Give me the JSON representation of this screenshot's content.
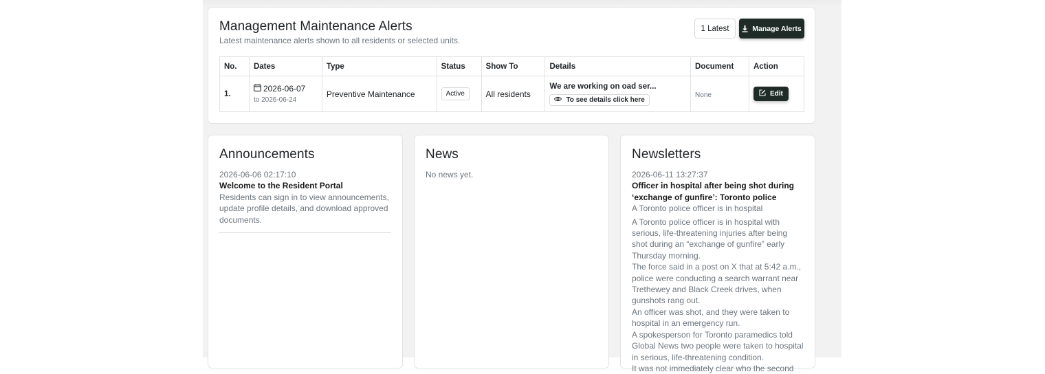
{
  "alerts": {
    "title": "Management Maintenance Alerts",
    "subtitle": "Latest maintenance alerts shown to all residents or selected units.",
    "latest_label": "1 Latest",
    "manage_label": "Manage Alerts",
    "columns": [
      "No.",
      "Dates",
      "Type",
      "Status",
      "Show To",
      "Details",
      "Document",
      "Action"
    ],
    "rows": [
      {
        "no": "1.",
        "date_start": "2026-06-07",
        "date_end": "to 2026-06-24",
        "type": "Preventive Maintenance",
        "status": "Active",
        "show_to": "All residents",
        "details_title": "We are working on oad ser...",
        "details_link": "To see details click here",
        "document": "None",
        "action": "Edit"
      }
    ]
  },
  "announcements": {
    "title": "Announcements",
    "items": [
      {
        "timestamp": "2026-06-06 02:17:10",
        "headline": "Welcome to the Resident Portal",
        "body": "Residents can sign in to view announcements, update profile details, and download approved documents."
      }
    ]
  },
  "news": {
    "title": "News",
    "empty_text": "No news yet."
  },
  "newsletters": {
    "title": "Newsletters",
    "timestamp": "2026-06-11 13:27:37",
    "headline": "Officer in hospital after being shot during ‘exchange of gunfire’: Toronto police",
    "summary": "A Toronto police officer is in hospital",
    "paragraphs": [
      "A Toronto police officer is in hospital with serious, life-threatening injuries after being shot during an “exchange of gunfire” early Thursday morning.",
      "The force said in a post on X that at 5:42 a.m., police were conducting a search warrant near Trethewey and Black Creek drives, when gunshots rang out.",
      "An officer was shot, and they were taken to hospital in an emergency run.",
      "A spokesperson for Toronto paramedics told Global News two people were taken to hospital in serious, life-threatening condition.",
      "It was not immediately clear who the second"
    ]
  },
  "colors": {
    "page_background": "#f2f2f2",
    "card_background": "#ffffff",
    "dark_button": "#1e2b27",
    "muted_text": "#6c757d"
  },
  "icons": {
    "manage": "download-icon",
    "date": "calendar-icon",
    "details": "eye-icon",
    "edit": "edit-icon"
  }
}
